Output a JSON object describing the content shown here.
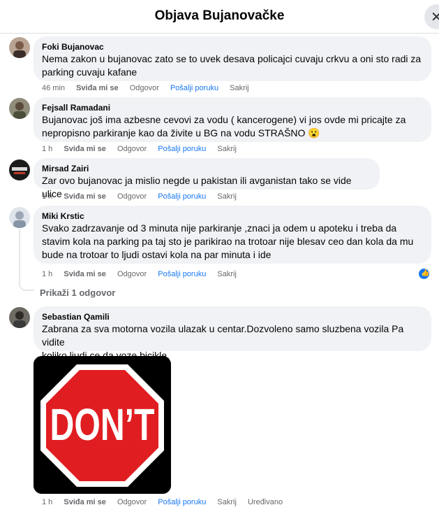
{
  "header": {
    "title": "Objava Bujanovačke",
    "close_glyph": "✕"
  },
  "comments": [
    {
      "author": "Foki Bujanovac",
      "lines": [
        "Nema zakon u bujanovac zato se to uvek desava policajci cuvaju crkvu a oni sto radi za",
        "parking cuvaju kafane"
      ],
      "time": "46 min"
    },
    {
      "author": "Fejsall Ramadani",
      "lines": [
        "Bujanovac još ima azbesne cevovi za vodu ( kancerogene) vi jos ovde mi pricajte za",
        "nepropisno parkiranje kao da živite u BG na vodu STRAŠNO 😮"
      ],
      "time": "1 h"
    },
    {
      "author": "Mirsad Zairi",
      "lines": [
        "Zar ovo bujanovac ja mislio negde u pakistan ili avganistan tako se vide ulice"
      ],
      "time": "1 h"
    },
    {
      "author": "Miki Krstic",
      "lines": [
        "Svako zadrzavanje od 3 minuta nije parkiranje ,znaci ja odem u apoteku i treba da",
        "stavim kola na parking pa taj sto je parikirao na trotoar nije blesav ceo dan kola da mu",
        "bude na trotoar to ljudi ostavi kola na par minuta i ide"
      ],
      "time": "1 h",
      "replies_link": "Prikaži 1 odgovor"
    },
    {
      "author": "Sebastian Qamili",
      "lines": [
        "Zabrana za sva motorna vozila ulazak u centar.Dozvoleno samo sluzbena vozila Pa vidite",
        "koliko ljudi ce da voze bicikle."
      ],
      "time": "1 h",
      "edited": "Uređivano",
      "image_text": "DON’T"
    }
  ],
  "actions": {
    "like": "Sviđa mi se",
    "reply": "Odgovor",
    "message": "Pošalji poruku",
    "hide": "Sakrij"
  },
  "colors": {
    "link": "#1877f2",
    "muted": "#65676b",
    "bubble": "#f0f2f5",
    "stop_red": "#e01e22"
  }
}
